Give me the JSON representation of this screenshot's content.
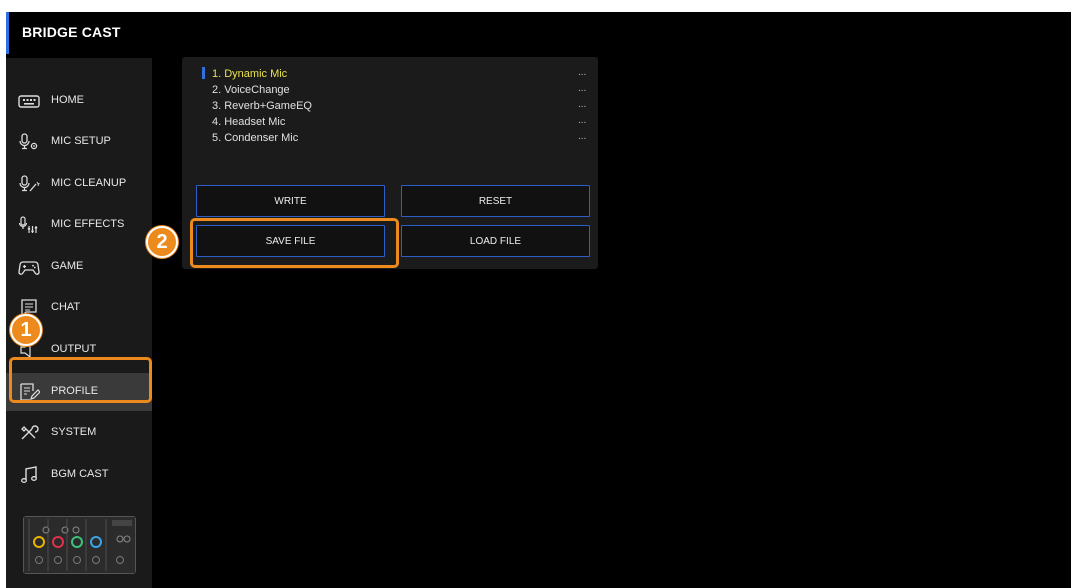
{
  "app": {
    "title": "BRIDGE CAST"
  },
  "sidebar": {
    "items": [
      {
        "label": "HOME",
        "icon": "keyboard-icon"
      },
      {
        "label": "MIC SETUP",
        "icon": "mic-gear-icon"
      },
      {
        "label": "MIC CLEANUP",
        "icon": "mic-wand-icon"
      },
      {
        "label": "MIC EFFECTS",
        "icon": "mic-sliders-icon"
      },
      {
        "label": "GAME",
        "icon": "gamepad-icon"
      },
      {
        "label": "CHAT",
        "icon": "chat-icon"
      },
      {
        "label": "OUTPUT",
        "icon": "output-icon"
      },
      {
        "label": "PROFILE",
        "icon": "profile-edit-icon"
      },
      {
        "label": "SYSTEM",
        "icon": "tools-icon"
      },
      {
        "label": "BGM CAST",
        "icon": "music-note-icon"
      }
    ],
    "active": "PROFILE"
  },
  "profiles": {
    "items": [
      {
        "name": "1. Dynamic Mic",
        "dots": "..."
      },
      {
        "name": "2. VoiceChange",
        "dots": "..."
      },
      {
        "name": "3. Reverb+GameEQ",
        "dots": "..."
      },
      {
        "name": "4. Headset Mic",
        "dots": "..."
      },
      {
        "name": "5. Condenser Mic",
        "dots": "..."
      }
    ],
    "selected": "1. Dynamic Mic"
  },
  "buttons": {
    "write": "WRITE",
    "reset": "RESET",
    "save_file": "SAVE FILE",
    "load_file": "LOAD FILE"
  },
  "callouts": [
    {
      "number": "1",
      "target": "PROFILE"
    },
    {
      "number": "2",
      "target": "SAVE FILE"
    }
  ],
  "colors": {
    "accent": "#2f6fe0",
    "selected_text": "#e9e34a",
    "callout": "#ec8a1e",
    "background": "#000000"
  }
}
